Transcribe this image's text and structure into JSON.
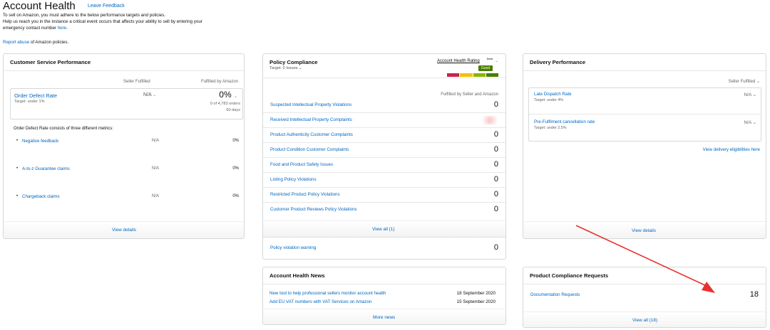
{
  "header": {
    "title": "Account Health",
    "leave_feedback": "Leave Feedback",
    "intro_line1": "To sell on Amazon, you must adhere to the below performance targets and policies.",
    "intro_line2": "Help us reach you in the instance a critical event occurs that affects your ability to sell by entering your",
    "intro_line3a": "emergency contact number ",
    "intro_line3_link": "here",
    "intro_line3b": ".",
    "report_link": "Report abuse",
    "report_suffix": " of Amazon policies."
  },
  "csp": {
    "title": "Customer Service Performance",
    "col_seller": "Seller Fulfilled",
    "col_amazon": "Fulfilled by Amazon",
    "odr_label": "Order Defect Rate",
    "odr_target": "Target: under 1%",
    "odr_seller_value": "N/A",
    "odr_amazon_value": "0%",
    "odr_amazon_orders": "0 of 4,783 orders",
    "odr_amazon_days": "60 days",
    "metrics_intro": "Order Defect Rate consists of three different metrics:",
    "metrics": [
      {
        "label": "Negative feedback",
        "seller": "N/A",
        "amazon": "0%"
      },
      {
        "label": "A-to-z Guarantee claims",
        "seller": "N/A",
        "amazon": "0%"
      },
      {
        "label": "Chargeback claims",
        "seller": "N/A",
        "amazon": "0%"
      }
    ],
    "view_details": "View details"
  },
  "policy": {
    "title": "Policy Compliance",
    "target": "Target: 0 Issues",
    "rating_label": "Account Health Rating",
    "rating_beta": "Beta",
    "rating_status": "Good",
    "rating_colors": [
      "#c7254e",
      "#f0c300",
      "#8cb400",
      "#4a7c00"
    ],
    "col_header": "Fulfilled by Seller and Amazon",
    "rows": [
      {
        "label": "Suspected Intellectual Property Violations",
        "value": "0"
      },
      {
        "label": "Received Intellectual Property Complaints",
        "value": ""
      },
      {
        "label": "Product Authenticity Customer Complaints",
        "value": "0"
      },
      {
        "label": "Product Condition Customer Complaints",
        "value": "0"
      },
      {
        "label": "Food and Product Safety Issues",
        "value": "0"
      },
      {
        "label": "Listing Policy Violations",
        "value": "0"
      },
      {
        "label": "Restricted Product Policy Violations",
        "value": "0"
      },
      {
        "label": "Customer Product Reviews Policy Violations",
        "value": "0"
      }
    ],
    "view_all": "View all (1)",
    "warning_label": "Policy violation warning",
    "warning_value": "0"
  },
  "delivery": {
    "title": "Delivery Performance",
    "filter": "Seller Fulfilled",
    "items": [
      {
        "label": "Late Dispatch Rate",
        "target": "Target: under 4%",
        "value": "N/A"
      },
      {
        "label": "Pre-Fulfilment cancellation rate",
        "target": "Target: under 2.5%",
        "value": "N/A"
      }
    ],
    "eligibility_link": "View delivery eligibilities here",
    "view_details": "View details"
  },
  "news": {
    "title": "Account Health News",
    "items": [
      {
        "label": "New tool to help professional sellers monitor account health",
        "date": "18 September 2020"
      },
      {
        "label": "Add EU VAT numbers with VAT Services on Amazon",
        "date": "15 September 2020"
      }
    ],
    "more": "More news"
  },
  "pcr": {
    "title": "Product Compliance Requests",
    "doc_label": "Documentation Requests",
    "doc_value": "18",
    "view_all": "View all (18)"
  },
  "annotation": {
    "arrow_color": "#e8312f"
  }
}
